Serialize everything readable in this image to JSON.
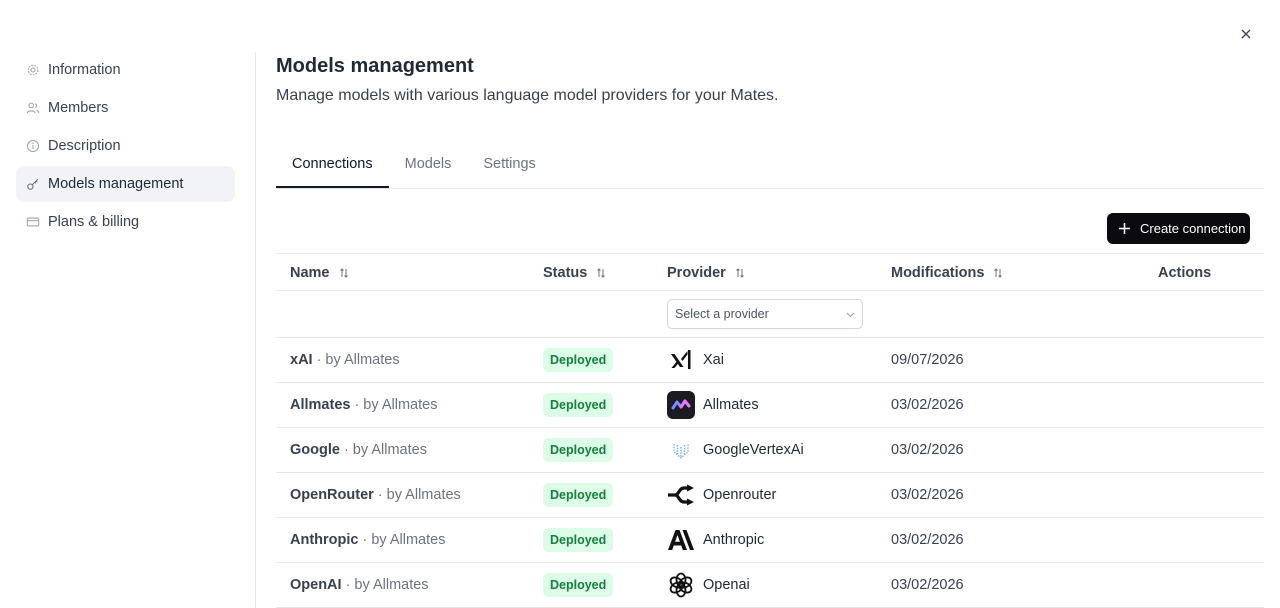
{
  "sidebar": {
    "items": [
      {
        "label": "Information",
        "icon": "gear-icon"
      },
      {
        "label": "Members",
        "icon": "users-icon"
      },
      {
        "label": "Description",
        "icon": "info-icon"
      },
      {
        "label": "Models management",
        "icon": "key-icon",
        "active": true
      },
      {
        "label": "Plans & billing",
        "icon": "credit-card-icon"
      }
    ]
  },
  "header": {
    "title": "Models management",
    "subtitle": "Manage models with various language model providers for your Mates."
  },
  "tabs": [
    {
      "label": "Connections",
      "active": true
    },
    {
      "label": "Models"
    },
    {
      "label": "Settings"
    }
  ],
  "toolbar": {
    "create_label": "Create connection"
  },
  "table": {
    "columns": [
      "Name",
      "Status",
      "Provider",
      "Modifications",
      "Actions"
    ],
    "provider_filter_placeholder": "Select a provider",
    "rows": [
      {
        "name": "xAI",
        "by": "· by Allmates",
        "status": "Deployed",
        "provider": "Xai",
        "provider_icon": "xai-logo-icon",
        "modified": "09/07/2026"
      },
      {
        "name": "Allmates",
        "by": "· by Allmates",
        "status": "Deployed",
        "provider": "Allmates",
        "provider_icon": "allmates-logo-icon",
        "modified": "03/02/2026"
      },
      {
        "name": "Google",
        "by": "· by Allmates",
        "status": "Deployed",
        "provider": "GoogleVertexAi",
        "provider_icon": "vertex-ai-logo-icon",
        "modified": "03/02/2026"
      },
      {
        "name": "OpenRouter",
        "by": "· by Allmates",
        "status": "Deployed",
        "provider": "Openrouter",
        "provider_icon": "openrouter-logo-icon",
        "modified": "03/02/2026"
      },
      {
        "name": "Anthropic",
        "by": "· by Allmates",
        "status": "Deployed",
        "provider": "Anthropic",
        "provider_icon": "anthropic-logo-icon",
        "modified": "03/02/2026"
      },
      {
        "name": "OpenAI",
        "by": "· by Allmates",
        "status": "Deployed",
        "provider": "Openai",
        "provider_icon": "openai-logo-icon",
        "modified": "03/02/2026"
      }
    ]
  },
  "colors": {
    "accent": "#0b0b0f",
    "badge_bg": "#dcfce7",
    "badge_text": "#15803d",
    "active_nav": "#f1f3f7"
  }
}
